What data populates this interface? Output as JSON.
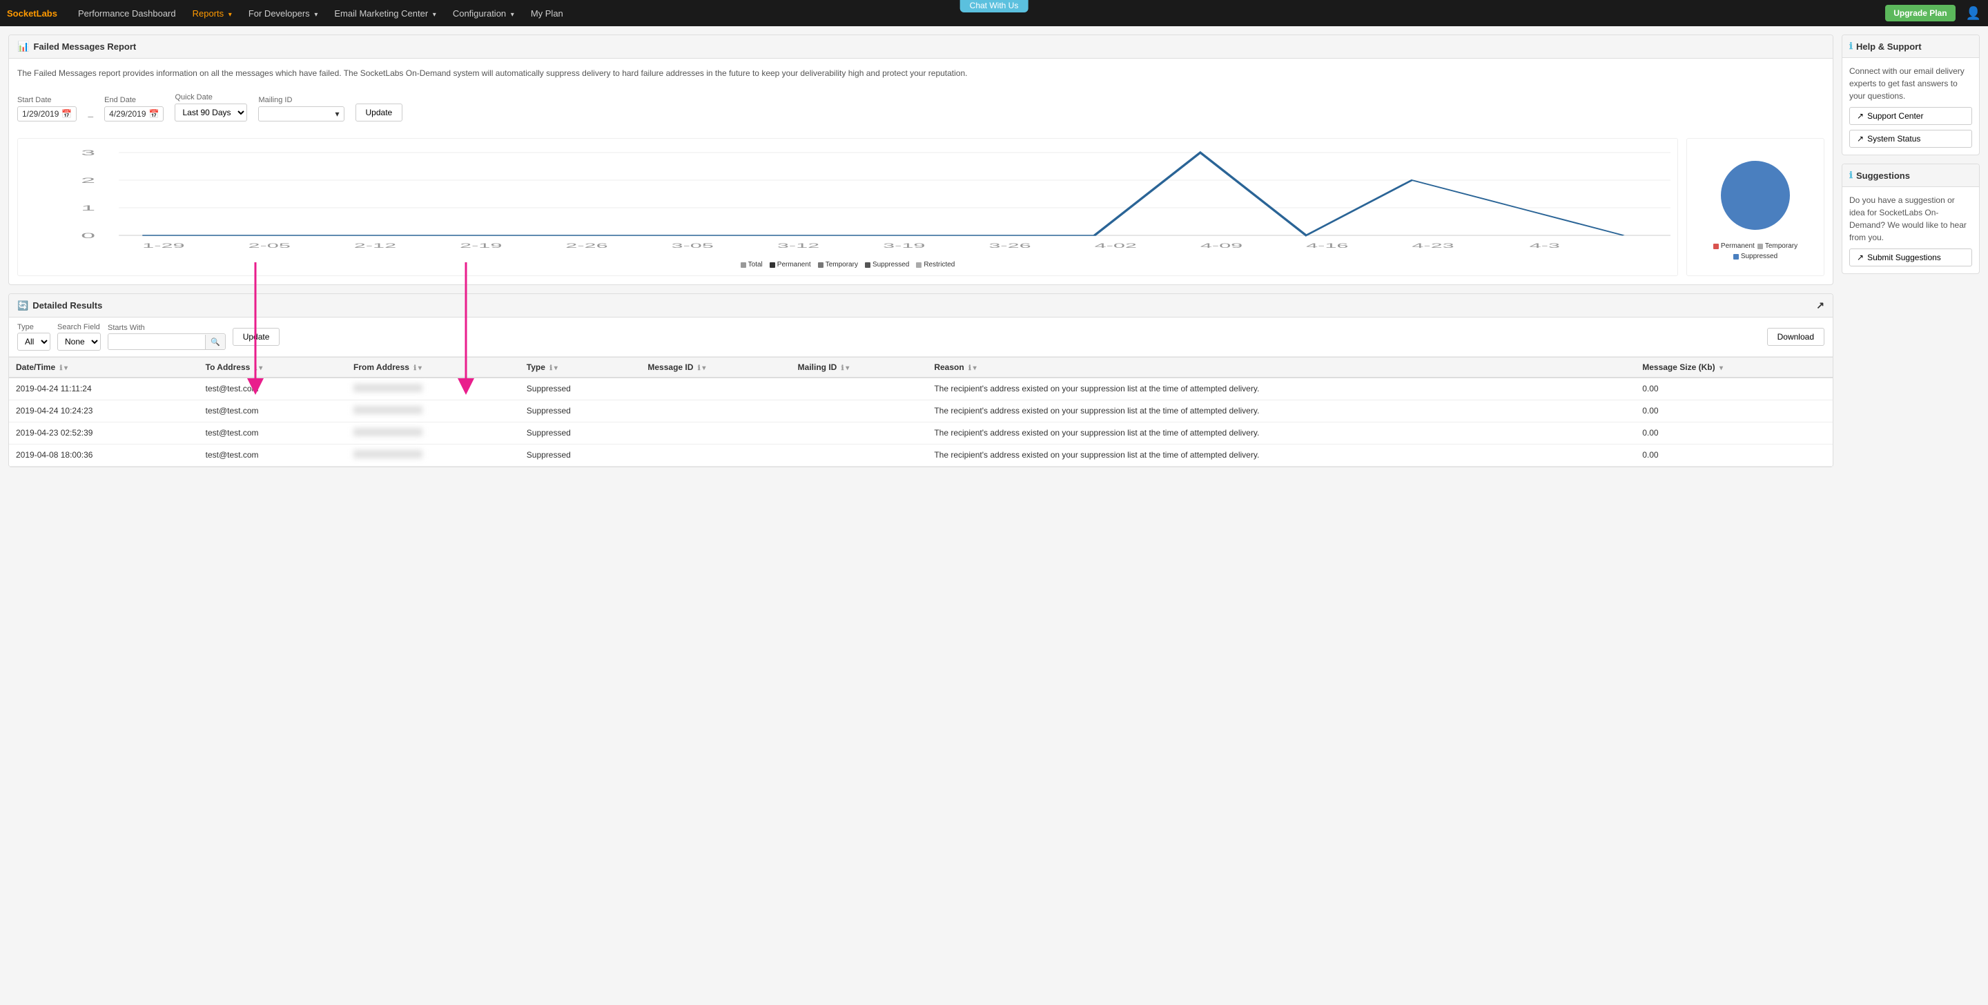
{
  "brand": "SocketLabs",
  "nav": {
    "chat_badge": "Chat With Us",
    "items": [
      {
        "label": "Performance Dashboard",
        "active": false
      },
      {
        "label": "Reports",
        "active": true,
        "has_arrow": true
      },
      {
        "label": "For Developers",
        "active": false,
        "has_arrow": true
      },
      {
        "label": "Email Marketing Center",
        "active": false,
        "has_arrow": true
      },
      {
        "label": "Configuration",
        "active": false,
        "has_arrow": true
      },
      {
        "label": "My Plan",
        "active": false
      }
    ],
    "upgrade_btn": "Upgrade Plan"
  },
  "report": {
    "title": "Failed Messages Report",
    "description": "The Failed Messages report provides information on all the messages which have failed. The SocketLabs On-Demand system will automatically suppress delivery to hard failure addresses in the future to keep your deliverability high and protect your reputation.",
    "filters": {
      "start_date_label": "Start Date",
      "start_date": "1/29/2019",
      "end_date_label": "End Date",
      "end_date": "4/29/2019",
      "quick_date_label": "Quick Date",
      "quick_date_value": "Last 90 Days",
      "mailing_id_label": "Mailing ID",
      "update_btn": "Update"
    }
  },
  "chart": {
    "y_labels": [
      "3",
      "2",
      "1",
      "0"
    ],
    "x_labels": [
      "1-29",
      "2-05",
      "2-12",
      "2-19",
      "2-26",
      "3-05",
      "3-12",
      "3-19",
      "3-26",
      "4-02",
      "4-09",
      "4-16",
      "4-23",
      "4-3"
    ],
    "legend": [
      {
        "label": "Total",
        "color": "#999"
      },
      {
        "label": "Permanent",
        "color": "#333"
      },
      {
        "label": "Temporary",
        "color": "#777"
      },
      {
        "label": "Suppressed",
        "color": "#555"
      },
      {
        "label": "Restricted",
        "color": "#aaa"
      }
    ],
    "pie_legend": [
      {
        "label": "Permanent",
        "color": "#d9534f"
      },
      {
        "label": "Temporary",
        "color": "#aaa"
      },
      {
        "label": "Suppressed",
        "color": "#4a7fbf"
      }
    ]
  },
  "detailed": {
    "title": "Detailed Results",
    "search": {
      "type_label": "Type",
      "type_value": "All",
      "field_label": "Search Field",
      "field_value": "None",
      "starts_with_label": "Starts With",
      "starts_with_placeholder": "",
      "update_btn": "Update",
      "download_btn": "Download"
    },
    "table": {
      "columns": [
        {
          "label": "Date/Time",
          "has_info": true
        },
        {
          "label": "To Address",
          "has_info": true
        },
        {
          "label": "From Address",
          "has_info": true
        },
        {
          "label": "Type",
          "has_info": true
        },
        {
          "label": "Message ID",
          "has_info": true
        },
        {
          "label": "Mailing ID",
          "has_info": true
        },
        {
          "label": "Reason",
          "has_info": true
        },
        {
          "label": "Message Size (Kb)",
          "has_info": false
        }
      ],
      "rows": [
        {
          "datetime": "2019-04-24 11:11:24",
          "to_address": "test@test.com",
          "from_address": "BLURRED",
          "type": "Suppressed",
          "message_id": "",
          "mailing_id": "",
          "reason": "The recipient's address existed on your suppression list at the time of attempted delivery.",
          "message_size": "0.00"
        },
        {
          "datetime": "2019-04-24 10:24:23",
          "to_address": "test@test.com",
          "from_address": "BLURRED",
          "type": "Suppressed",
          "message_id": "",
          "mailing_id": "",
          "reason": "The recipient's address existed on your suppression list at the time of attempted delivery.",
          "message_size": "0.00"
        },
        {
          "datetime": "2019-04-23 02:52:39",
          "to_address": "test@test.com",
          "from_address": "BLURRED",
          "type": "Suppressed",
          "message_id": "",
          "mailing_id": "",
          "reason": "The recipient's address existed on your suppression list at the time of attempted delivery.",
          "message_size": "0.00"
        },
        {
          "datetime": "2019-04-08 18:00:36",
          "to_address": "test@test.com",
          "from_address": "BLURRED",
          "type": "Suppressed",
          "message_id": "",
          "mailing_id": "",
          "reason": "The recipient's address existed on your suppression list at the time of attempted delivery.",
          "message_size": "0.00"
        }
      ]
    }
  },
  "sidebar": {
    "help": {
      "title": "Help & Support",
      "description": "Connect with our email delivery experts to get fast answers to your questions.",
      "support_btn": "Support Center",
      "status_btn": "System Status"
    },
    "suggestions": {
      "title": "Suggestions",
      "description": "Do you have a suggestion or idea for SocketLabs On-Demand? We would like to hear from you.",
      "submit_btn": "Submit Suggestions"
    }
  }
}
